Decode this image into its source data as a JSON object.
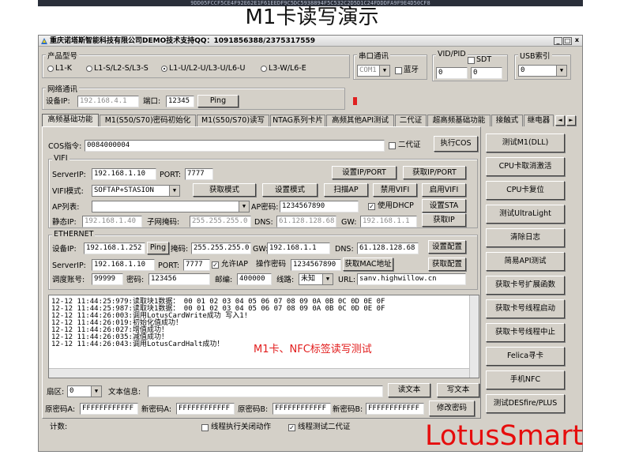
{
  "top_strip_text": "9DD05FCCF5CE4F92E62E1F61EEDF9C5DC5938894F5C532C2D5D1C24FDDDFA9F9E4D50CF8",
  "heading": "M1卡读写演示",
  "window": {
    "title": "重庆诺塔斯智能科技有限公司DEMO技术支持QQ：1091856388/2375317559",
    "min": "_",
    "max": "□",
    "close": "x"
  },
  "product": {
    "label": "产品型号",
    "options": [
      "L1-K",
      "L1-S/L2-S/L3-S",
      "L1-U/L2-U/L3-U/L6-U",
      "L3-W/L6-E"
    ],
    "selected_index": 2
  },
  "serial": {
    "label": "串口通讯",
    "port": "COM1",
    "bluetooth_label": "蓝牙"
  },
  "vidpid": {
    "label": "VID/PID",
    "sdt_label": "SDT",
    "vid": "0",
    "pid": "0"
  },
  "usb": {
    "label": "USB索引",
    "value": "0"
  },
  "network": {
    "label": "网络通讯",
    "ip_label": "设备IP:",
    "ip": "192.168.4.1",
    "port_label": "端口:",
    "port": "12345",
    "ping": "Ping"
  },
  "tabs": [
    "高频基础功能",
    "M1(S50/S70)密码初始化",
    "M1(S50/S70)读写",
    "NTAG系列卡片",
    "高频其他API测试",
    "二代证",
    "超高频基础功能",
    "接触式",
    "继电器"
  ],
  "tab_scroll": {
    "left": "◄",
    "right": "►"
  },
  "cos": {
    "label": "COS指令:",
    "value": "0084000004",
    "idcard_label": "二代证",
    "exec": "执行COS"
  },
  "wifi": {
    "label": "VIFI",
    "server_ip_label": "ServerIP:",
    "server_ip": "192.168.1.10",
    "port_label": "PORT:",
    "port": "7777",
    "set_ipport": "设置IP/PORT",
    "get_ipport": "获取IP/PORT",
    "mode_label": "VIFI模式:",
    "mode": "SOFTAP+STASION",
    "get_mode": "获取模式",
    "set_mode": "设置模式",
    "scan_ap": "扫描AP",
    "disable_wifi": "禁用VIFI",
    "enable_wifi": "启用VIFI",
    "ap_list_label": "AP列表:",
    "ap_pwd_label": "AP密码:",
    "ap_pwd": "1234567890",
    "dhcp_label": "使用DHCP",
    "set_sta": "设置STA",
    "static_ip_label": "静态IP:",
    "static_ip": "192.168.1.40",
    "mask_label": "子网掩码:",
    "mask": "255.255.255.0",
    "dns_label": "DNS:",
    "dns": "61.128.128.68",
    "gw_label": "GW:",
    "gw": "192.168.1.1",
    "get_ip": "获取IP"
  },
  "ethernet": {
    "label": "ETHERNET",
    "ip_label": "设备IP:",
    "ip": "192.168.1.252",
    "ping": "Ping",
    "mask_label": "掩码:",
    "mask": "255.255.255.0",
    "gw_label": "GW:",
    "gw": "192.168.1.1",
    "dns_label": "DNS:",
    "dns": "61.128.128.68",
    "set_cfg": "设置配置",
    "server_ip_label": "ServerIP:",
    "server_ip": "192.168.1.10",
    "port_label": "PORT:",
    "port": "7777",
    "allow_iap_label": "允许IAP",
    "op_pwd_label": "操作密码",
    "op_pwd": "1234567890",
    "get_mac": "获取MAC地址",
    "get_cfg": "获取配置",
    "account_label": "调度账号:",
    "account": "99999",
    "pwd_label": "密码:",
    "pwd": "123456",
    "zip_label": "邮编:",
    "zip": "400000",
    "line_label": "线路:",
    "line": "未知",
    "url_label": "URL:",
    "url": "sanv.highwillow.cn"
  },
  "log": [
    "12-12 11:44:25:979:读取块1数据：  00 01 02 03 04 05 06 07 08 09 0A 0B 0C 0D 0E 0F",
    "12-12 11:44:25:987:读取块1数据：  00 01 02 03 04 05 06 07 08 09 0A 0B 0C 0D 0E 0F",
    "12-12 11:44:26:003:调用LotusCardWrite成功 写入1!",
    "12-12 11:44:26:019:初始化值成功！",
    "12-12 11:44:26:027:增值成功！",
    "12-12 11:44:26:035:减值成功！",
    "12-12 11:44:26:043:调用LotusCardHalt成功！"
  ],
  "overlay_caption": "M1卡、NFC标签读写测试",
  "sector": {
    "label": "扇区:",
    "value": "0",
    "text_info_label": "文本信息:",
    "read_text": "读文本",
    "write_text": "写文本"
  },
  "keys": {
    "orig_a_label": "原密码A:",
    "orig_a": "FFFFFFFFFFFF",
    "new_a_label": "新密码A:",
    "new_a": "FFFFFFFFFFFF",
    "orig_b_label": "原密码B:",
    "orig_b": "FFFFFFFFFFFF",
    "new_b_label": "新密码B:",
    "new_b": "FFFFFFFFFFFF",
    "change_pwd": "修改密码"
  },
  "bottom": {
    "count_label": "计数:",
    "auto_close_label": "线程执行关闭动作",
    "thread_test_label": "线程测试二代证"
  },
  "side_buttons": [
    "测试M1(DLL)",
    "CPU卡取消激活",
    "CPU卡复位",
    "测试UltraLight",
    "清除日志",
    "简易API测试",
    "获取卡号扩展函数",
    "获取卡号线程启动",
    "获取卡号线程中止",
    "Felica寻卡",
    "手机NFC",
    "测试DESfire/PLUS"
  ],
  "brand": "LotusSmart",
  "colors": {
    "window_bg": "#d4d0c8",
    "brand_red": "#e60d0d",
    "status_red": "#e02020"
  }
}
